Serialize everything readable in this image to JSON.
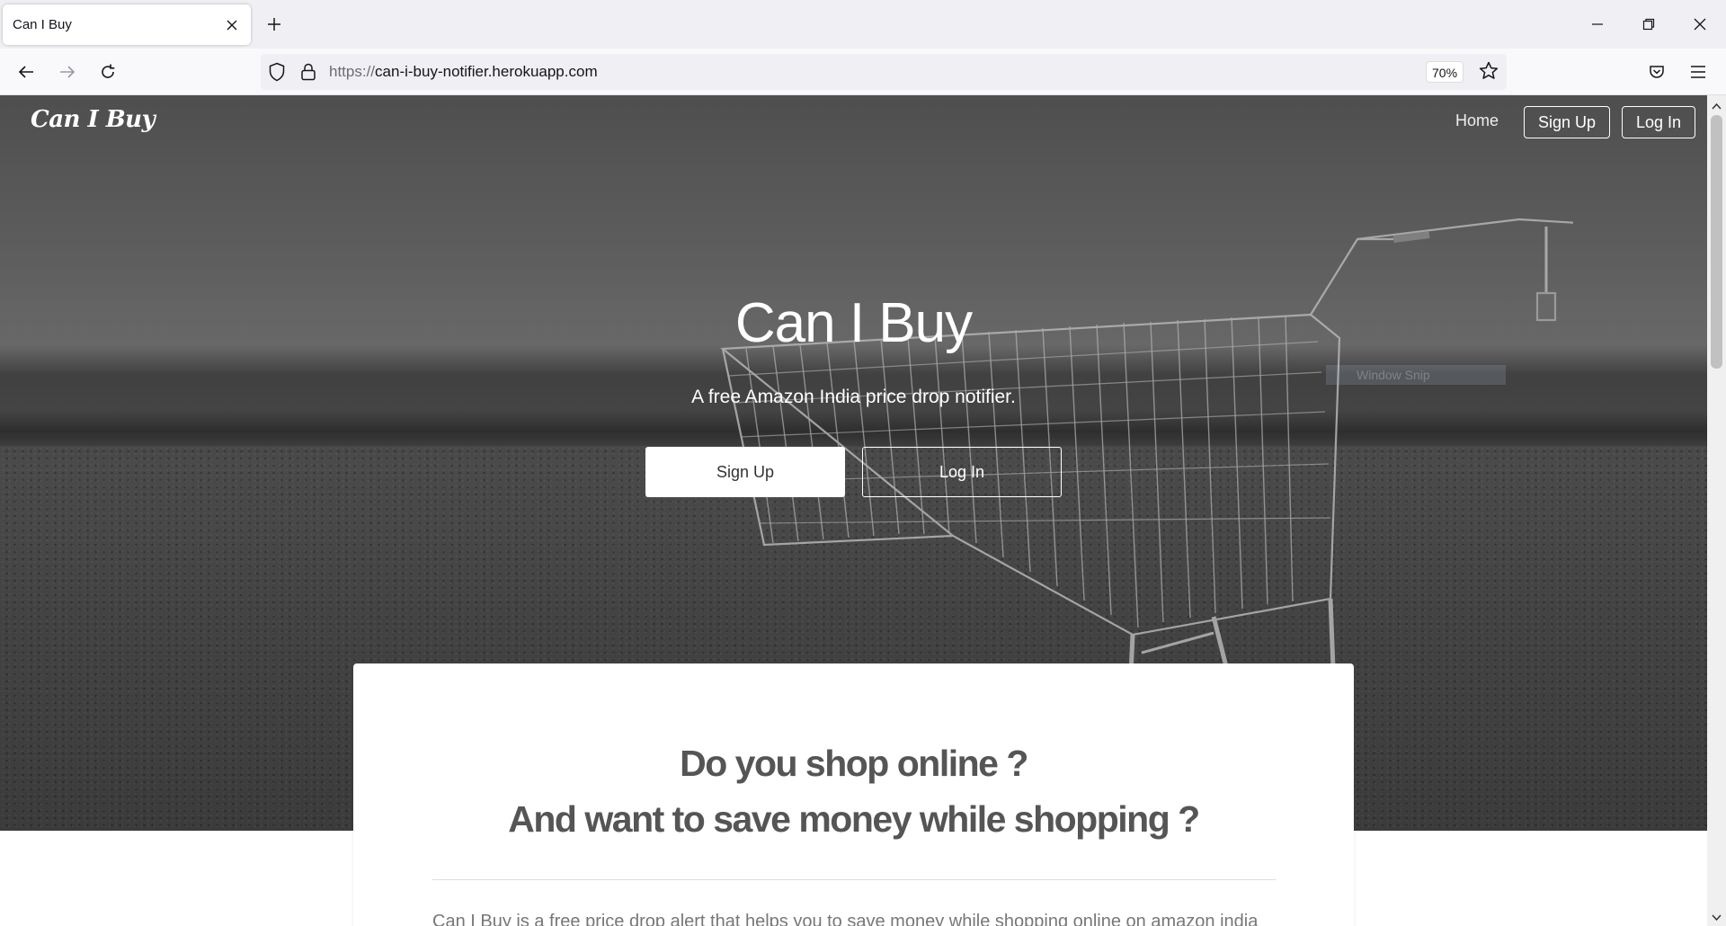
{
  "browser": {
    "tab_title": "Can I Buy",
    "url_protocol": "https://",
    "url_host": "can-i-buy-notifier.herokuapp.com",
    "zoom": "70%"
  },
  "site": {
    "brand": "Can I Buy",
    "nav": {
      "home": "Home",
      "signup": "Sign Up",
      "login": "Log In"
    }
  },
  "hero": {
    "title": "Can I Buy",
    "subtitle": "A free Amazon India price drop notifier.",
    "signup": "Sign Up",
    "login": "Log In"
  },
  "overlay": {
    "snip_label": "Window Snip"
  },
  "card": {
    "question_1": "Do you shop online ?",
    "question_2": "And want to save money while shopping ?",
    "body": "Can I Buy is a free price drop alert that helps you to save money while shopping online on amazon india"
  },
  "colors": {
    "hero_overlay": "#000000",
    "text_light": "#ffffff",
    "card_text": "#555555"
  }
}
